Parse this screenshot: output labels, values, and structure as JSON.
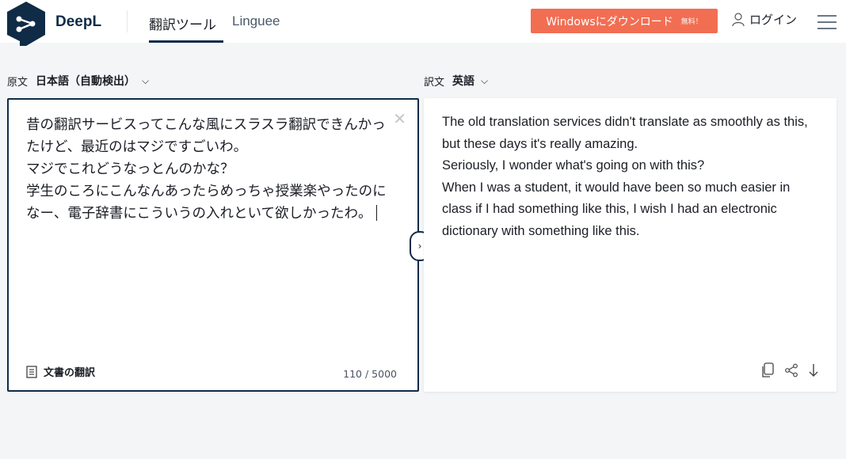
{
  "header": {
    "brand": "DeepL",
    "nav": {
      "translator": "翻訳ツール",
      "linguee": "Linguee"
    },
    "download_button": {
      "label": "Windowsにダウンロード",
      "badge": "無料！"
    },
    "login_label": "ログイン",
    "icons": {
      "logo": "deepl-logo",
      "user": "user-icon",
      "menu": "menu-icon"
    }
  },
  "source": {
    "label": "原文",
    "language": "日本語（自動検出）",
    "text": "昔の翻訳サービスってこんな風にスラスラ翻訳できんかったけど、最近のはマジですごいわ。\nマジでこれどうなっとんのかな？\n学生のころにこんなんあったらめっちゃ授業楽やったのになー、電子辞書にこういうの入れといて欲しかったわ。",
    "document_button": "文書の翻訳",
    "char_count": "110 / 5000"
  },
  "target": {
    "label": "訳文",
    "language": "英語",
    "text": "The old translation services didn't translate as smoothly as this, but these days it's really amazing.\nSeriously, I wonder what's going on with this?\nWhen I was a student, it would have been so much easier in class if I had something like this, I wish I had an electronic dictionary with something like this."
  },
  "colors": {
    "accent": "#0f2b46",
    "download": "#f26e52",
    "background": "#f3f5f7"
  }
}
